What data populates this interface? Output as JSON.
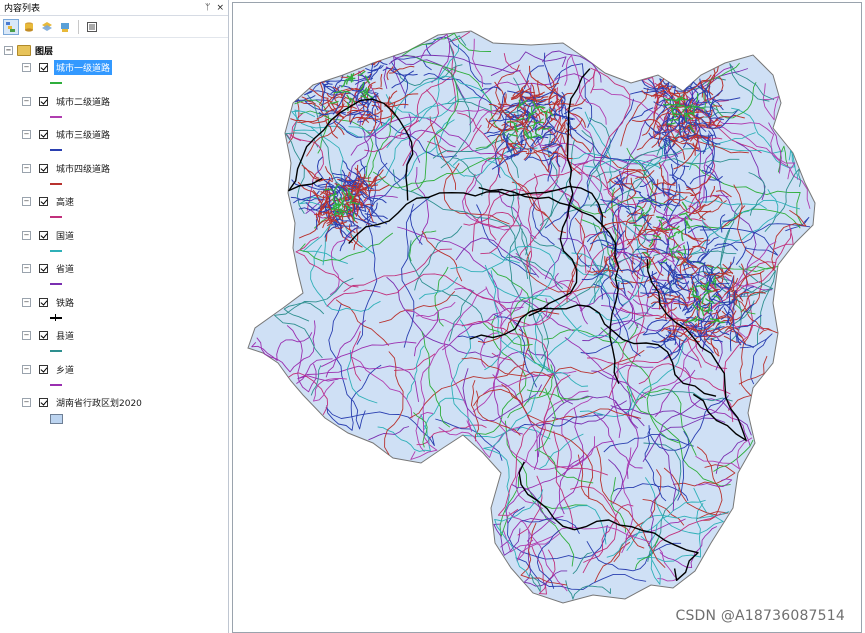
{
  "toc": {
    "title": "内容列表",
    "pin_glyph": "ᛘ",
    "close_glyph": "×",
    "toolbar": {
      "buttons": [
        "list-by-drawing-order-icon",
        "list-by-source-icon",
        "list-by-visibility-icon",
        "list-by-selection-icon",
        "options-icon"
      ]
    },
    "root_label": "图层",
    "layers": [
      {
        "label": "城市一级道路",
        "color": "#2fae3c",
        "symbol": "line",
        "selected": true
      },
      {
        "label": "城市二级道路",
        "color": "#b03db0",
        "symbol": "line"
      },
      {
        "label": "城市三级道路",
        "color": "#2a3fb0",
        "symbol": "line"
      },
      {
        "label": "城市四级道路",
        "color": "#b8322f",
        "symbol": "line"
      },
      {
        "label": "高速",
        "color": "#c1307c",
        "symbol": "line"
      },
      {
        "label": "国道",
        "color": "#2fb0b8",
        "symbol": "line"
      },
      {
        "label": "省道",
        "color": "#7a2fb0",
        "symbol": "line"
      },
      {
        "label": "铁路",
        "color": "#000000",
        "symbol": "rail"
      },
      {
        "label": "县道",
        "color": "#2e8f8f",
        "symbol": "line"
      },
      {
        "label": "乡道",
        "color": "#9a2fb0",
        "symbol": "line"
      },
      {
        "label": "湖南省行政区划2020",
        "color": "#bcd4f0",
        "symbol": "polygon"
      }
    ]
  },
  "map": {
    "fill_color": "#cfe0f5",
    "outline_color": "#777777"
  },
  "watermark": "CSDN @A18736087514"
}
